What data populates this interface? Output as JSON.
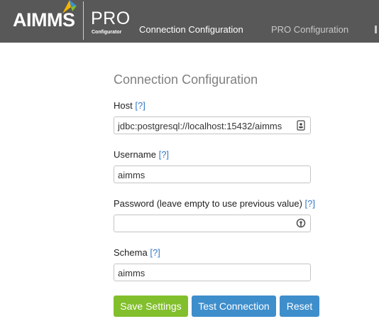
{
  "header": {
    "logo_text": "AIMMS",
    "product": "PRO",
    "product_sub": "Configurator",
    "nav": [
      {
        "label": "Connection Configuration",
        "active": true
      },
      {
        "label": "PRO Configuration",
        "active": false
      }
    ]
  },
  "form": {
    "title": "Connection Configuration",
    "help_text": "[?]",
    "host": {
      "label": "Host",
      "value": "jdbc:postgresql://localhost:15432/aimms",
      "icon": "contact-card-icon"
    },
    "username": {
      "label": "Username",
      "value": "aimms"
    },
    "password": {
      "label": "Password (leave empty to use previous value)",
      "value": "",
      "icon": "key-icon"
    },
    "schema": {
      "label": "Schema",
      "value": "aimms"
    }
  },
  "buttons": {
    "save": "Save Settings",
    "test": "Test Connection",
    "reset": "Reset"
  },
  "colors": {
    "header_bg": "#585858",
    "save_green": "#82bf2c",
    "action_blue": "#3e8ecc",
    "link_blue": "#3478c8"
  }
}
